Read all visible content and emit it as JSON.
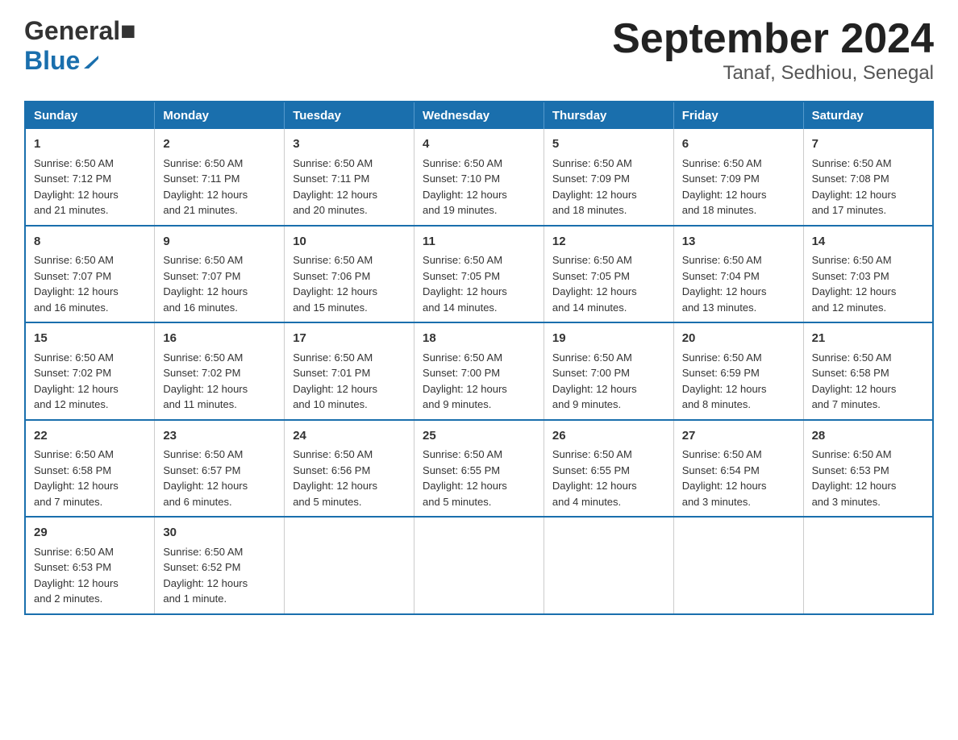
{
  "header": {
    "logo_general": "General",
    "logo_blue": "Blue",
    "month_title": "September 2024",
    "location": "Tanaf, Sedhiou, Senegal"
  },
  "days_of_week": [
    "Sunday",
    "Monday",
    "Tuesday",
    "Wednesday",
    "Thursday",
    "Friday",
    "Saturday"
  ],
  "weeks": [
    [
      {
        "day": "1",
        "sunrise": "6:50 AM",
        "sunset": "7:12 PM",
        "daylight": "12 hours and 21 minutes."
      },
      {
        "day": "2",
        "sunrise": "6:50 AM",
        "sunset": "7:11 PM",
        "daylight": "12 hours and 21 minutes."
      },
      {
        "day": "3",
        "sunrise": "6:50 AM",
        "sunset": "7:11 PM",
        "daylight": "12 hours and 20 minutes."
      },
      {
        "day": "4",
        "sunrise": "6:50 AM",
        "sunset": "7:10 PM",
        "daylight": "12 hours and 19 minutes."
      },
      {
        "day": "5",
        "sunrise": "6:50 AM",
        "sunset": "7:09 PM",
        "daylight": "12 hours and 18 minutes."
      },
      {
        "day": "6",
        "sunrise": "6:50 AM",
        "sunset": "7:09 PM",
        "daylight": "12 hours and 18 minutes."
      },
      {
        "day": "7",
        "sunrise": "6:50 AM",
        "sunset": "7:08 PM",
        "daylight": "12 hours and 17 minutes."
      }
    ],
    [
      {
        "day": "8",
        "sunrise": "6:50 AM",
        "sunset": "7:07 PM",
        "daylight": "12 hours and 16 minutes."
      },
      {
        "day": "9",
        "sunrise": "6:50 AM",
        "sunset": "7:07 PM",
        "daylight": "12 hours and 16 minutes."
      },
      {
        "day": "10",
        "sunrise": "6:50 AM",
        "sunset": "7:06 PM",
        "daylight": "12 hours and 15 minutes."
      },
      {
        "day": "11",
        "sunrise": "6:50 AM",
        "sunset": "7:05 PM",
        "daylight": "12 hours and 14 minutes."
      },
      {
        "day": "12",
        "sunrise": "6:50 AM",
        "sunset": "7:05 PM",
        "daylight": "12 hours and 14 minutes."
      },
      {
        "day": "13",
        "sunrise": "6:50 AM",
        "sunset": "7:04 PM",
        "daylight": "12 hours and 13 minutes."
      },
      {
        "day": "14",
        "sunrise": "6:50 AM",
        "sunset": "7:03 PM",
        "daylight": "12 hours and 12 minutes."
      }
    ],
    [
      {
        "day": "15",
        "sunrise": "6:50 AM",
        "sunset": "7:02 PM",
        "daylight": "12 hours and 12 minutes."
      },
      {
        "day": "16",
        "sunrise": "6:50 AM",
        "sunset": "7:02 PM",
        "daylight": "12 hours and 11 minutes."
      },
      {
        "day": "17",
        "sunrise": "6:50 AM",
        "sunset": "7:01 PM",
        "daylight": "12 hours and 10 minutes."
      },
      {
        "day": "18",
        "sunrise": "6:50 AM",
        "sunset": "7:00 PM",
        "daylight": "12 hours and 9 minutes."
      },
      {
        "day": "19",
        "sunrise": "6:50 AM",
        "sunset": "7:00 PM",
        "daylight": "12 hours and 9 minutes."
      },
      {
        "day": "20",
        "sunrise": "6:50 AM",
        "sunset": "6:59 PM",
        "daylight": "12 hours and 8 minutes."
      },
      {
        "day": "21",
        "sunrise": "6:50 AM",
        "sunset": "6:58 PM",
        "daylight": "12 hours and 7 minutes."
      }
    ],
    [
      {
        "day": "22",
        "sunrise": "6:50 AM",
        "sunset": "6:58 PM",
        "daylight": "12 hours and 7 minutes."
      },
      {
        "day": "23",
        "sunrise": "6:50 AM",
        "sunset": "6:57 PM",
        "daylight": "12 hours and 6 minutes."
      },
      {
        "day": "24",
        "sunrise": "6:50 AM",
        "sunset": "6:56 PM",
        "daylight": "12 hours and 5 minutes."
      },
      {
        "day": "25",
        "sunrise": "6:50 AM",
        "sunset": "6:55 PM",
        "daylight": "12 hours and 5 minutes."
      },
      {
        "day": "26",
        "sunrise": "6:50 AM",
        "sunset": "6:55 PM",
        "daylight": "12 hours and 4 minutes."
      },
      {
        "day": "27",
        "sunrise": "6:50 AM",
        "sunset": "6:54 PM",
        "daylight": "12 hours and 3 minutes."
      },
      {
        "day": "28",
        "sunrise": "6:50 AM",
        "sunset": "6:53 PM",
        "daylight": "12 hours and 3 minutes."
      }
    ],
    [
      {
        "day": "29",
        "sunrise": "6:50 AM",
        "sunset": "6:53 PM",
        "daylight": "12 hours and 2 minutes."
      },
      {
        "day": "30",
        "sunrise": "6:50 AM",
        "sunset": "6:52 PM",
        "daylight": "12 hours and 1 minute."
      },
      null,
      null,
      null,
      null,
      null
    ]
  ],
  "labels": {
    "sunrise": "Sunrise:",
    "sunset": "Sunset:",
    "daylight": "Daylight:"
  }
}
